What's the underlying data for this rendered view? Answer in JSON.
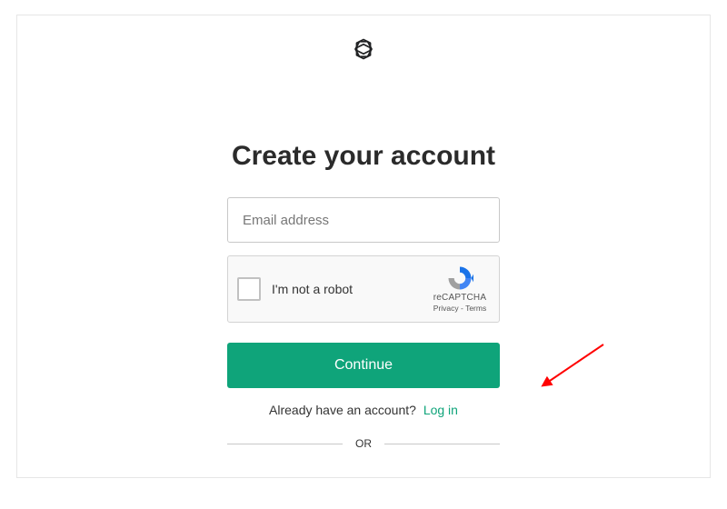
{
  "logo": {
    "name": "openai-logo"
  },
  "form": {
    "title": "Create your account",
    "email_placeholder": "Email address",
    "captcha": {
      "label": "I'm not a robot",
      "brand": "reCAPTCHA",
      "links": "Privacy - Terms"
    },
    "continue_label": "Continue",
    "login_prompt": "Already have an account?",
    "login_link": "Log in",
    "divider": "OR"
  },
  "colors": {
    "accent": "#0fa47a"
  }
}
